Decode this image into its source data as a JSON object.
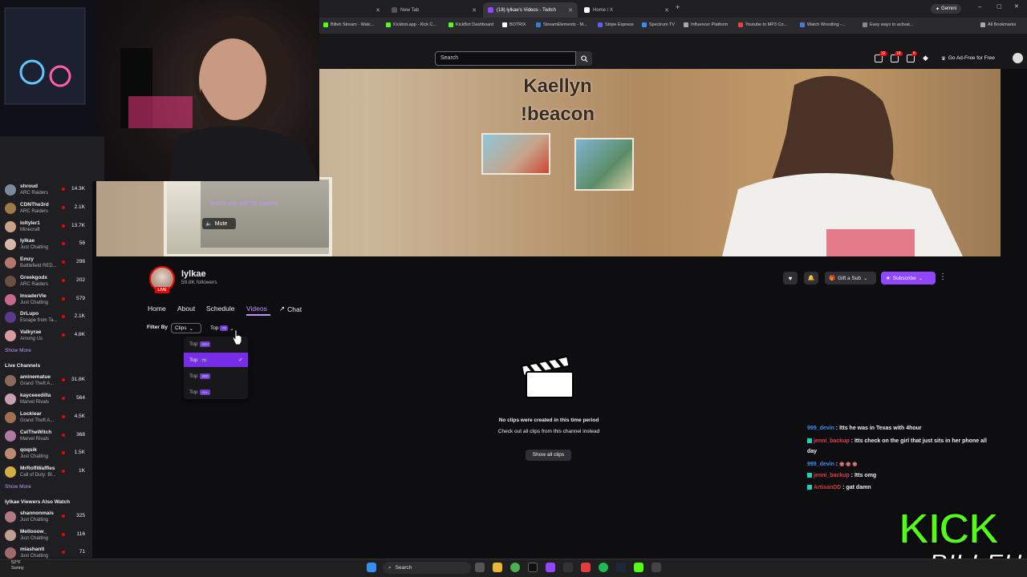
{
  "browser": {
    "tabs": [
      {
        "label": "New Tab"
      },
      {
        "label": "(18) lylkae's Videos - Twitch"
      },
      {
        "label": "Home / X"
      }
    ],
    "gemini_label": "Gemini",
    "all_bookmarks": "All Bookmarks",
    "bookmarks": [
      "Billeh Stream - Watc...",
      "Kickbot.app - Kick C...",
      "KickBot Dashboard",
      "BOTRIX",
      "StreamElements - M...",
      "Stripe Express",
      "Spectrum TV",
      "Influencer Platform",
      "Youtube to MP3 Co...",
      "Watch Wrestling -...",
      "Easy ways to activat..."
    ]
  },
  "topnav": {
    "search_placeholder": "Search",
    "badge_1": "32",
    "badge_2": "18",
    "badge_3": "8",
    "ad_free": "Go Ad-Free for Free"
  },
  "video": {
    "overlay_line1": "Kaellyn",
    "overlay_line2": "!beacon",
    "watch_now": "Watch now with 58 viewers",
    "mute": "Mute"
  },
  "sidebar": {
    "followed": [
      {
        "name": "shroud",
        "game": "ARC Raiders",
        "viewers": "14.3K",
        "color": "#7a8a9a"
      },
      {
        "name": "CDNThe3rd",
        "game": "ARC Raiders",
        "viewers": "2.1K",
        "color": "#9a7a4a"
      },
      {
        "name": "loltyler1",
        "game": "Minecraft",
        "viewers": "13.7K",
        "color": "#c9a28a"
      },
      {
        "name": "lylkae",
        "game": "Just Chatting",
        "viewers": "56",
        "color": "#d8b8a8"
      },
      {
        "name": "Emzy",
        "game": "Battlefield RED...",
        "viewers": "298",
        "color": "#b07a6a"
      },
      {
        "name": "Greekgodx",
        "game": "ARC Raiders",
        "viewers": "202",
        "color": "#6a5040"
      },
      {
        "name": "InvaderVie",
        "game": "Just Chatting",
        "viewers": "579",
        "color": "#c46a8a"
      },
      {
        "name": "DrLupo",
        "game": "Escape from Ta...",
        "viewers": "2.1K",
        "color": "#5a3a8a"
      },
      {
        "name": "Valkyrae",
        "game": "Among Us",
        "viewers": "4.8K",
        "color": "#d89aa0"
      }
    ],
    "show_more_1": "Show More",
    "live_channels_title": "Live Channels",
    "live": [
      {
        "name": "aminematue",
        "game": "Grand Theft A...",
        "viewers": "31.8K",
        "color": "#8a6a5a"
      },
      {
        "name": "kayceeedilla",
        "game": "Marvel Rivals",
        "viewers": "564",
        "color": "#c8a0b0"
      },
      {
        "name": "Locklear",
        "game": "Grand Theft A...",
        "viewers": "4.5K",
        "color": "#a07050"
      },
      {
        "name": "CelTheWitch",
        "game": "Marvel Rivals",
        "viewers": "368",
        "color": "#b07aa0"
      },
      {
        "name": "qoqsik",
        "game": "Just Chatting",
        "viewers": "1.5K",
        "color": "#c08a70"
      },
      {
        "name": "MrRoflWaffles",
        "game": "Call of Duty: Bl...",
        "viewers": "1K",
        "color": "#d0b040"
      }
    ],
    "show_more_2": "Show More",
    "also_watch_title": "lylkae Viewers Also Watch",
    "also_watch": [
      {
        "name": "shannonmais",
        "game": "Just Chatting",
        "viewers": "325",
        "color": "#b07a80"
      },
      {
        "name": "Mellooow_",
        "game": "Just Chatting",
        "viewers": "116",
        "color": "#c0a090"
      },
      {
        "name": "miashanti",
        "game": "Just Chatting",
        "viewers": "71",
        "color": "#a06a6a"
      }
    ]
  },
  "channel": {
    "name": "lylkae",
    "followers": "59.8K followers",
    "live_badge": "LIVE",
    "tabs": [
      "Home",
      "About",
      "Schedule",
      "Videos"
    ],
    "chat_tab": "Chat",
    "gift_sub": "Gift a Sub",
    "subscribe": "Subscribe"
  },
  "filter": {
    "label": "Filter By",
    "type_value": "Clips",
    "sort_prefix": "Top",
    "sort_pill": "7D",
    "options": [
      {
        "prefix": "Top",
        "pill": "24H",
        "selected": false
      },
      {
        "prefix": "Top",
        "pill": "7D",
        "selected": true
      },
      {
        "prefix": "Top",
        "pill": "30D",
        "selected": false
      },
      {
        "prefix": "Top",
        "pill": "ALL",
        "selected": false
      }
    ]
  },
  "empty_state": {
    "title": "No clips were created in this time period",
    "subtitle": "Check out all clips from this channel instead",
    "button": "Show all clips"
  },
  "chat_overlay": [
    {
      "user": "999_devin",
      "msg": "Itts he was in Texas with 4hour"
    },
    {
      "user": "jenni_backup",
      "msg": "Itts check on the girl that just sits in her phone all"
    },
    {
      "user": "",
      "msg": "day"
    },
    {
      "user": "999_devin",
      "msg": ""
    },
    {
      "user": "jenni_backup",
      "msg": "Itts omg"
    },
    {
      "user": "ArtisanDD",
      "msg": "gat damn"
    }
  ],
  "taskbar": {
    "search": "Search",
    "temp": "52°F",
    "weather": "Sunny"
  },
  "logo_text": "KICK BILLEH"
}
